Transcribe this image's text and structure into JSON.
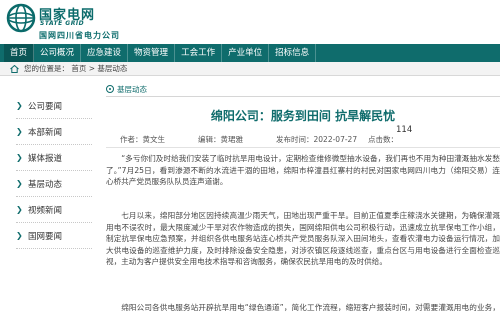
{
  "brand": {
    "name_cn": "国家电网",
    "name_en": "STATE GRID",
    "subsidiary": "国网四川省电力公司",
    "color": "#0f6c6c"
  },
  "nav": {
    "items": [
      {
        "label": "首页",
        "active": true
      },
      {
        "label": "公司概况"
      },
      {
        "label": "应急建设"
      },
      {
        "label": "物资管理"
      },
      {
        "label": "工会工作"
      },
      {
        "label": "产业单位"
      },
      {
        "label": "招标信息"
      }
    ]
  },
  "breadcrumb": {
    "text": "您的位置是： 首页 > 基层动态",
    "icon": "home-icon"
  },
  "sidebar": {
    "items": [
      {
        "label": "公司要闻"
      },
      {
        "label": "本部新闻"
      },
      {
        "label": "媒体报道"
      },
      {
        "label": "基层动态"
      },
      {
        "label": "视频新闻"
      },
      {
        "label": "国网要闻"
      }
    ]
  },
  "section": {
    "label": "基层动态"
  },
  "article": {
    "title": "绵阳公司：服务到田间 抗旱解民忧",
    "author": "作者：黄文生",
    "editor": "编辑：黄珺雅",
    "date": "发布时间：2022-07-27",
    "views_label": "点击数：",
    "views": "114",
    "paragraphs": [
      "“多亏你们及时给我们安装了临时抗旱用电设计，定期检查维修微型抽水设备，我们再也不用为种田灌溉抽水发愁了。”7月25日，看到渗源不断的水流进干涸的田地，绵阳市梓潼县红寨村的村民对国家电网四川电力（绵阳交易）连心桥共产党员服务队队员连声道谢。",
      "七月以来，绵阳部分地区因持续高温少雨天气，田地出现严重干旱。目前正值夏季庄稼浇水关键期，为确保灌溉用电不误农时，最大限度减少干旱对农作物造成的损失，国网绵阳供电公司积极行动，迅速成立抗旱保电工作小组，制定抗旱保电应急预案，并组织各供电服务站连心桥共产党员服务队深入田间地头，查看农灌电力设备运行情况，加大供电设备的巡查维护力度，及时排除设备安全隐患，对涉农镇区段逐线巡查，重点台区与用电设备进行全面检查巡视，主动为客户提供安全用电技术指导和咨询服务，确保农民抗旱用电的及时供给。",
      "绵阳公司各供电服务站开辟抗旱用电“绿色通道”，简化工作流程，缩短客户报装时间，对需要灌溉用电的业务，实行特事特办，24小时“零距离”服务，全力解决村民抗旱灌溉用电的燃眉之急。"
    ]
  }
}
